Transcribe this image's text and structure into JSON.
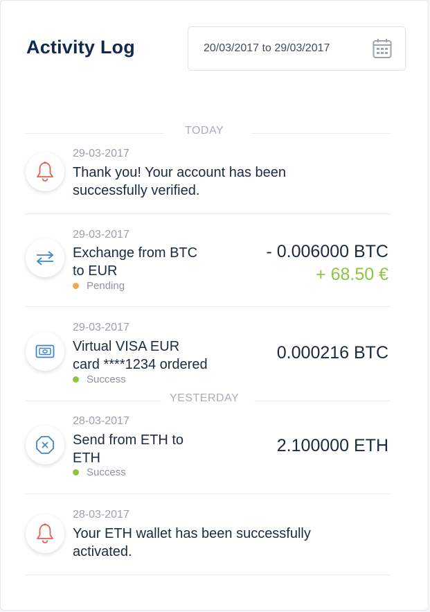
{
  "header": {
    "title": "Activity Log",
    "date_range": "20/03/2017 to 29/03/2017",
    "calendar_icon": "calendar-icon"
  },
  "sections": {
    "today": "TODAY",
    "yesterday": "YESTERDAY"
  },
  "items": [
    {
      "date": "29-03-2017",
      "line1": "Thank you! Your account has been",
      "line2": "successfully verified.",
      "icon": "bell-icon"
    },
    {
      "date": "29-03-2017",
      "line1": "Exchange from BTC",
      "line2": "to EUR",
      "status": "Pending",
      "amount": "- 0.006000 BTC",
      "amount2": "+ 68.50 €",
      "icon": "exchange-arrows-icon"
    },
    {
      "date": "29-03-2017",
      "line1": "Virtual VISA EUR",
      "line2": "card ****1234 ordered",
      "status": "Success",
      "amount": "0.000216 BTC",
      "icon": "banknote-icon"
    },
    {
      "date": "28-03-2017",
      "line1": "Send from ETH to",
      "line2": "ETH",
      "status": "Success",
      "amount": "2.100000 ETH",
      "icon": "cancel-octagon-icon"
    },
    {
      "date": "28-03-2017",
      "line1": "Your ETH wallet has been successfully",
      "line2": "activated.",
      "icon": "bell-icon"
    }
  ],
  "colors": {
    "title": "#13294b",
    "bell": "#e35d50",
    "blue": "#3f86c9",
    "pending": "#f0a64a",
    "success": "#8cc63f",
    "amount_positive": "#8cc63f"
  }
}
